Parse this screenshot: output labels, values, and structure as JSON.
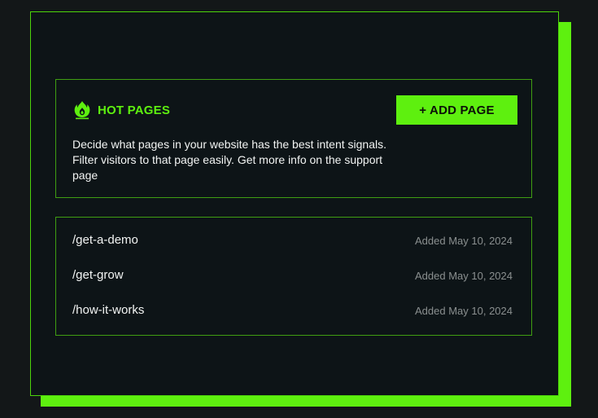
{
  "hot_pages": {
    "icon": "fire-icon",
    "title": "HOT PAGES",
    "description": "Decide what pages in your website has the best intent signals. Filter visitors to that page easily. Get more info on the support page",
    "add_button_label": "+ ADD PAGE"
  },
  "pages": [
    {
      "path": "/get-a-demo",
      "added": "Added May 10, 2024"
    },
    {
      "path": "/get-grow",
      "added": "Added May 10, 2024"
    },
    {
      "path": "/how-it-works",
      "added": "Added May 10, 2024"
    }
  ],
  "colors": {
    "accent": "#5ef00f",
    "panel_background": "#0d1417",
    "page_background": "#131718",
    "muted_text": "#8a8f8f"
  }
}
